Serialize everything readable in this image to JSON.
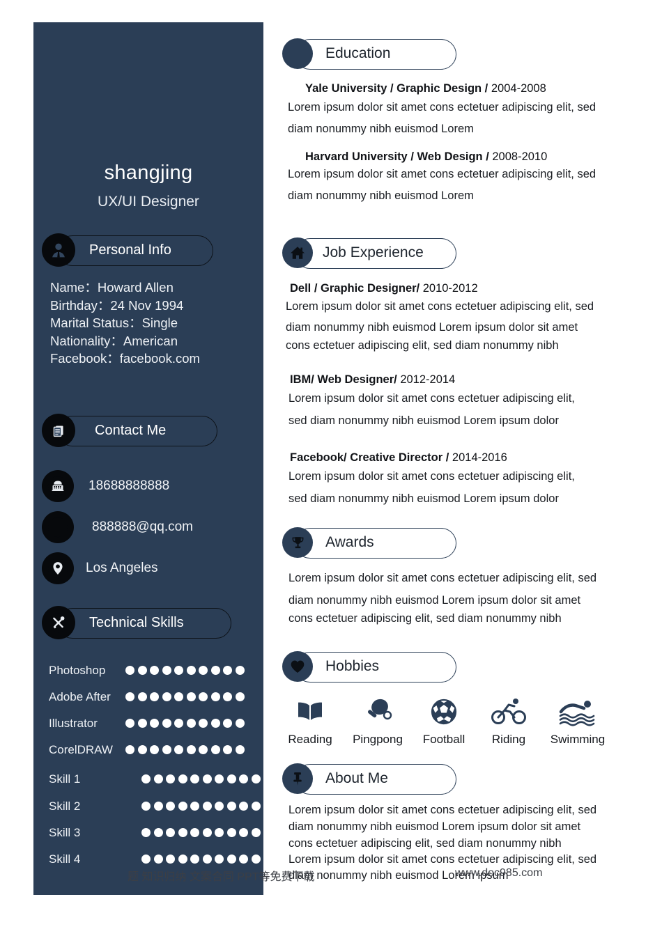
{
  "document": {
    "type": "resume",
    "accent_navy": "#2b3e56",
    "icon_black": "#07090c",
    "page_background": "#ffffff"
  },
  "sidebar": {
    "name": "shangjing",
    "role": "UX/UI Designer",
    "personal_info": {
      "heading": "Personal Info",
      "heading_icon": "person-badge-icon",
      "lines": [
        "Name：Howard Allen",
        "Birthday：24 Nov 1994",
        "Marital Status：Single",
        "Nationality：American",
        "Facebook：facebook.com"
      ]
    },
    "contact": {
      "heading": "Contact Me",
      "heading_icon": "documents-icon",
      "rows": [
        {
          "icon": "telephone-icon",
          "value": "18688888888"
        },
        {
          "icon": "email-icon",
          "value": "888888@qq.com"
        },
        {
          "icon": "location-pin-icon",
          "value": "Los Angeles"
        }
      ]
    },
    "skills": {
      "heading": "Technical Skills",
      "heading_icon": "tools-icon",
      "max_dots": 10,
      "items": [
        {
          "label": "Photoshop",
          "dots": 10
        },
        {
          "label": "Adobe After",
          "dots": 10
        },
        {
          "label": "Illustrator",
          "dots": 10
        },
        {
          "label": "CorelDRAW",
          "dots": 10
        },
        {
          "label": "Skill 1",
          "dots": 10
        },
        {
          "label": "Skill 2",
          "dots": 10
        },
        {
          "label": "Skill 3",
          "dots": 10
        },
        {
          "label": "Skill 4",
          "dots": 10
        }
      ]
    }
  },
  "main": {
    "education": {
      "heading": "Education",
      "heading_icon": "blank-circle-icon",
      "entries": [
        {
          "title_bold": "Yale University / Graphic Design /",
          "title_rest": " 2004-2008",
          "lines": [
            "Lorem ipsum dolor sit amet cons ectetuer adipiscing elit, sed",
            "diam nonummy nibh euismod  Lorem"
          ]
        },
        {
          "title_bold": "Harvard University / Web Design /",
          "title_rest": " 2008-2010",
          "lines": [
            "Lorem ipsum dolor sit amet cons ectetuer adipiscing elit, sed",
            "diam nonummy nibh euismod  Lorem"
          ]
        }
      ]
    },
    "job_experience": {
      "heading": "Job Experience",
      "heading_icon": "home-icon",
      "entries": [
        {
          "title_bold": "Dell / Graphic Designer/",
          "title_rest": " 2010-2012",
          "lines": [
            "Lorem ipsum dolor sit amet cons ectetuer adipiscing elit, sed",
            "diam nonummy nibh euismod  Lorem ipsum dolor sit amet",
            "cons ectetuer adipiscing elit, sed diam nonummy nibh"
          ]
        },
        {
          "title_bold": "IBM/ Web Designer/",
          "title_rest": " 2012-2014",
          "lines": [
            "Lorem ipsum dolor sit amet cons ectetuer adipiscing elit,",
            "sed diam nonummy nibh euismod  Lorem ipsum dolor"
          ]
        },
        {
          "title_bold": "Facebook/ Creative Director /",
          "title_rest": " 2014-2016",
          "lines": [
            "Lorem ipsum dolor sit amet cons ectetuer adipiscing elit,",
            "sed diam nonummy nibh euismod  Lorem ipsum dolor"
          ]
        }
      ]
    },
    "awards": {
      "heading": "Awards",
      "heading_icon": "trophy-icon",
      "lines": [
        "Lorem ipsum dolor sit amet cons ectetuer adipiscing elit, sed",
        "diam nonummy nibh euismod  Lorem ipsum dolor sit amet",
        "cons ectetuer adipiscing elit, sed diam nonummy nibh"
      ]
    },
    "hobbies": {
      "heading": "Hobbies",
      "heading_icon": "heart-icon",
      "items": [
        {
          "icon": "book-icon",
          "label": "Reading"
        },
        {
          "icon": "pingpong-paddle-icon",
          "label": "Pingpong"
        },
        {
          "icon": "soccer-ball-icon",
          "label": "Football"
        },
        {
          "icon": "bicycle-icon",
          "label": "Riding"
        },
        {
          "icon": "swimmer-icon",
          "label": "Swimming"
        }
      ]
    },
    "about_me": {
      "heading": "About Me",
      "heading_icon": "pushpin-icon",
      "lines": [
        "Lorem ipsum dolor sit amet cons ectetuer adipiscing elit, sed",
        "diam nonummy nibh euismod Lorem ipsum dolor sit amet",
        "cons ectetuer adipiscing elit, sed diam nonummy nibh",
        "Lorem ipsum dolor sit amet cons ectetuer adipiscing elit, sed",
        "diam nonummy nibh euismod  Lorem ipsum"
      ]
    }
  },
  "watermark": {
    "chinese": "题 知识归纳 文案合同 PPT等免费下载",
    "url": "www.doc985.com"
  }
}
